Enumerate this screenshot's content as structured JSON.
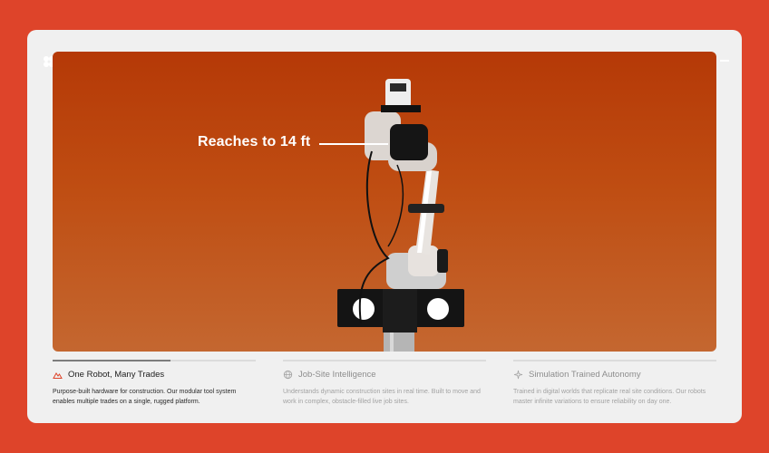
{
  "hero": {
    "callout": "Reaches to 14 ft"
  },
  "features": [
    {
      "title": "One Robot, Many Trades",
      "description": "Purpose-built hardware for construction. Our modular tool system enables multiple trades on a single, rugged platform.",
      "icon": "mountain-icon",
      "active": true,
      "progress": 0.58
    },
    {
      "title": "Job-Site Intelligence",
      "description": "Understands dynamic construction sites in real time. Built to move and work in complex, obstacle-filled live job sites.",
      "icon": "globe-icon",
      "active": false,
      "progress": 0
    },
    {
      "title": "Simulation Trained Autonomy",
      "description": "Trained in digital worlds that replicate real site conditions. Our robots master infinite variations to ensure reliability on day one.",
      "icon": "sparkle-icon",
      "active": false,
      "progress": 0
    }
  ],
  "colors": {
    "background": "#de442a",
    "card": "#f0f0f0",
    "hero_top": "#b53907",
    "hero_bottom": "#c46730",
    "accent": "#de442a"
  }
}
